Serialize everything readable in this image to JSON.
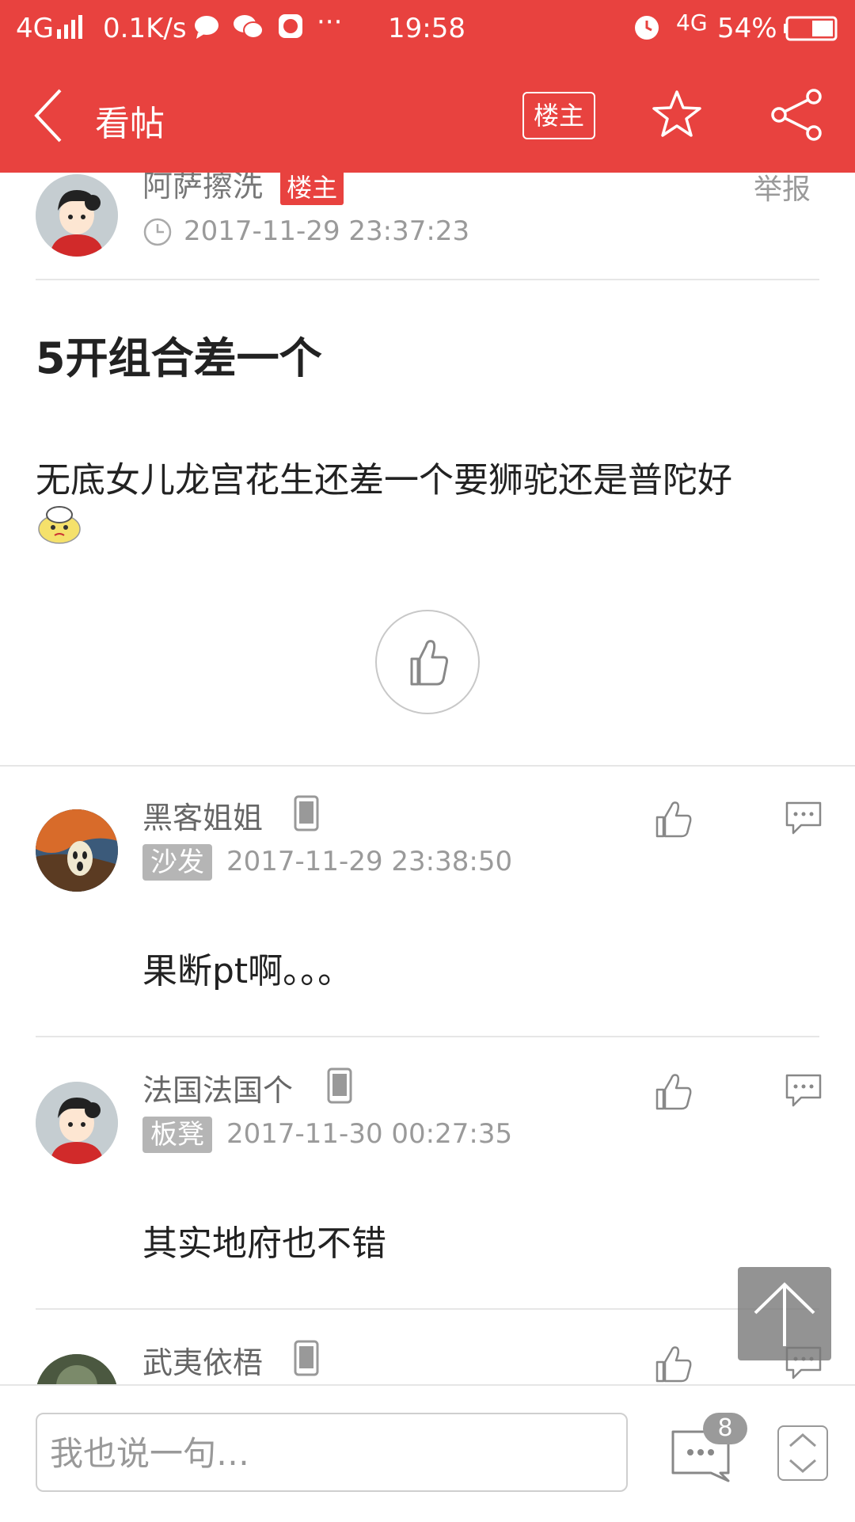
{
  "status_bar": {
    "network": "4G",
    "speed": "0.1K/s",
    "dots": "···",
    "time": "19:58",
    "network_right": "4G",
    "battery": "54%"
  },
  "nav": {
    "title": "看帖",
    "op_label": "楼主",
    "back_icon": "chevron-left-icon",
    "star_icon": "star-icon",
    "share_icon": "share-icon"
  },
  "post": {
    "author": "阿萨擦洗",
    "author_badge": "楼主",
    "report": "举报",
    "timestamp": "2017-11-29 23:37:23",
    "title": "5开组合差一个",
    "body": "无底女儿龙宫花生还差一个要狮驼还是普陀好"
  },
  "replies": [
    {
      "author": "黑客姐姐",
      "floor": "沙发",
      "timestamp": "2017-11-29 23:38:50",
      "body": "果断pt啊。。。"
    },
    {
      "author": "法国法国个",
      "floor": "板凳",
      "timestamp": "2017-11-30 00:27:35",
      "body": "其实地府也不错"
    },
    {
      "author": "武夷依梧"
    }
  ],
  "bottom": {
    "input_placeholder": "我也说一句…",
    "comment_count": "8"
  },
  "colors": {
    "brand": "#e8423f",
    "badge_gray": "#b5b5b5"
  }
}
